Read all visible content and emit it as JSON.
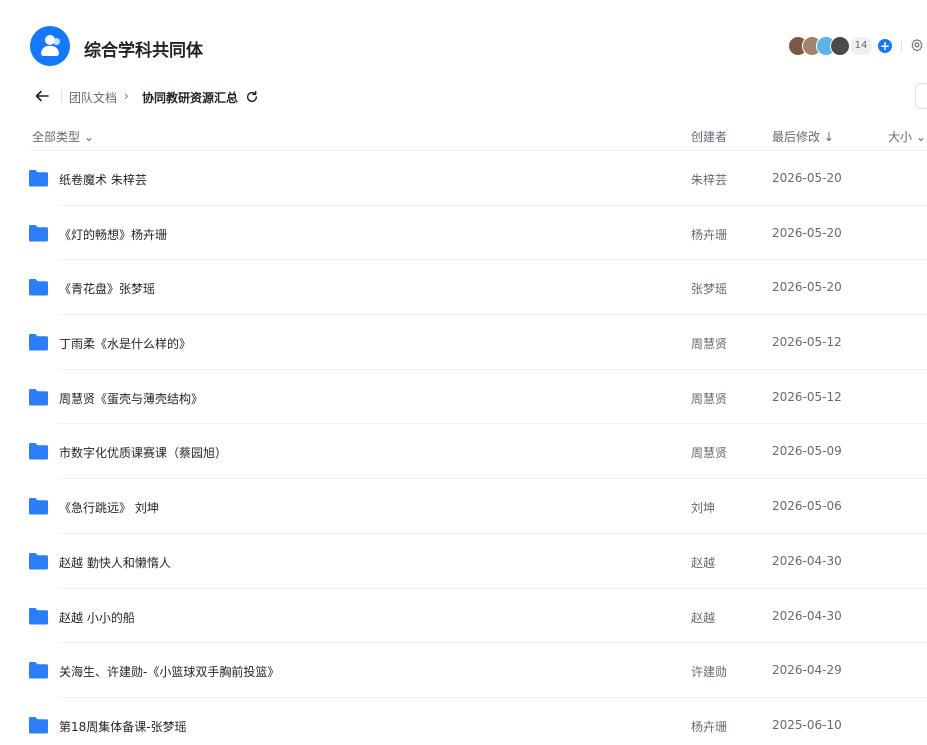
{
  "app": {
    "title": "综合学科共同体",
    "member_count": "14",
    "avatar_colors": [
      "#7a5b45",
      "#a1826a",
      "#5bb3e6",
      "#4a4a4a"
    ]
  },
  "breadcrumb": {
    "parent": "团队文档",
    "separator": "›",
    "current": "协同教研资源汇总"
  },
  "columns": {
    "type_filter": "全部类型 ⌄",
    "creator": "创建者",
    "modified": "最后修改 ↓",
    "size": "大小 ⌄"
  },
  "files": [
    {
      "name": "纸卷魔术 朱梓芸",
      "creator": "朱梓芸",
      "modified": "2026-05-20"
    },
    {
      "name": "《灯的畅想》杨卉珊",
      "creator": "杨卉珊",
      "modified": "2026-05-20"
    },
    {
      "name": "《青花盘》张梦瑶",
      "creator": "张梦瑶",
      "modified": "2026-05-20"
    },
    {
      "name": "丁雨柔《水是什么样的》",
      "creator": "周慧贤",
      "modified": "2026-05-12"
    },
    {
      "name": "周慧贤《蛋壳与薄壳结构》",
      "creator": "周慧贤",
      "modified": "2026-05-12"
    },
    {
      "name": "市数字化优质课赛课（蔡园旭）",
      "creator": "周慧贤",
      "modified": "2026-05-09"
    },
    {
      "name": "《急行跳远》 刘坤",
      "creator": "刘坤",
      "modified": "2026-05-06"
    },
    {
      "name": "赵越 勤快人和懒惰人",
      "creator": "赵越",
      "modified": "2026-04-30"
    },
    {
      "name": "赵越 小小的船",
      "creator": "赵越",
      "modified": "2026-04-30"
    },
    {
      "name": "关海生、许建勋-《小篮球双手胸前投篮》",
      "creator": "许建勋",
      "modified": "2026-04-29"
    },
    {
      "name": "第18周集体备课-张梦瑶",
      "creator": "杨卉珊",
      "modified": "2025-06-10"
    }
  ],
  "colors": {
    "accent": "#1677ff",
    "folder": "#2c7ef8",
    "text": "#1f2329",
    "muted": "#646a73"
  },
  "icons": {
    "logo": "team-logo-icon",
    "back": "arrow-left-icon",
    "refresh": "refresh-icon",
    "add": "plus-circle-icon",
    "settings": "gear-icon",
    "folder": "folder-icon"
  }
}
